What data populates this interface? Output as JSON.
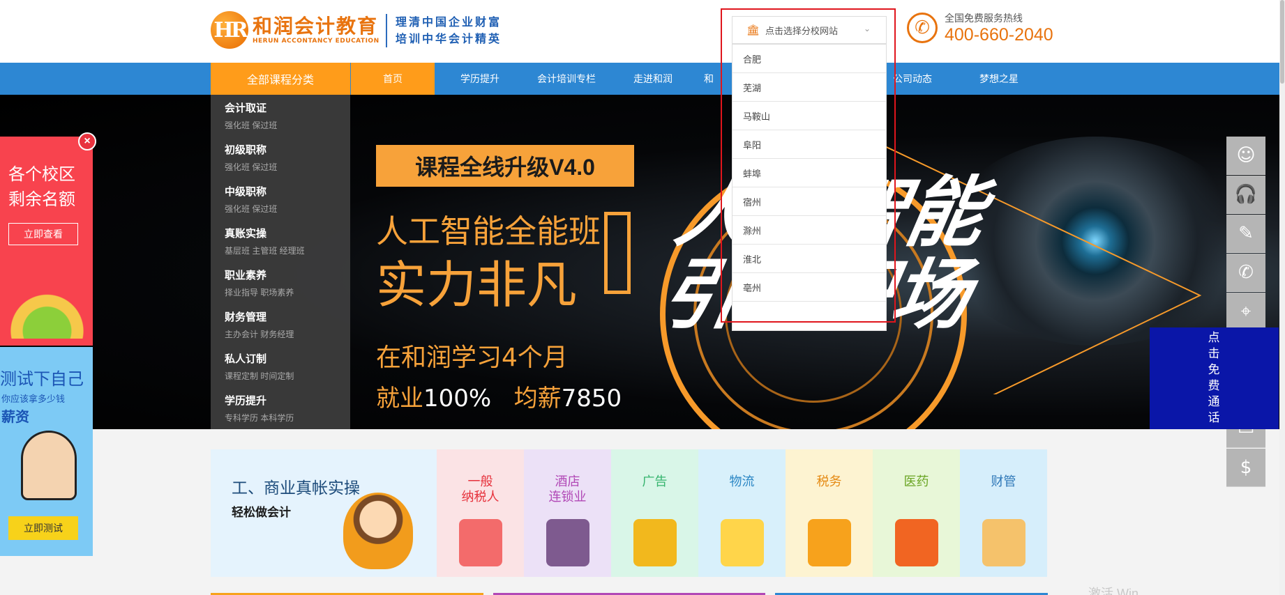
{
  "header": {
    "logo_mark": "HR",
    "logo_cn": "和润会计教育",
    "logo_en": "HERUN ACCONTANCY EDUCATION",
    "slogan_line1": "理清中国企业财富",
    "slogan_line2": "培训中华会计精英",
    "hotline_label": "全国免费服务热线",
    "hotline_number": "400-660-2040"
  },
  "branch_select": {
    "placeholder": "点击选择分校网站",
    "options": [
      "合肥",
      "芜湖",
      "马鞍山",
      "阜阳",
      "蚌埠",
      "宿州",
      "滁州",
      "淮北",
      "亳州"
    ]
  },
  "nav": {
    "category_label": "全部课程分类",
    "items": [
      "首页",
      "学历提升",
      "会计培训专栏",
      "走进和润",
      "和",
      "公司动态",
      "梦想之星"
    ]
  },
  "categories": [
    {
      "title": "会计取证",
      "sub": "强化班  保过班"
    },
    {
      "title": "初级职称",
      "sub": "强化班  保过班"
    },
    {
      "title": "中级职称",
      "sub": "强化班  保过班"
    },
    {
      "title": "真账实操",
      "sub": "基层班  主管班  经理班"
    },
    {
      "title": "职业素养",
      "sub": "择业指导  职场素养"
    },
    {
      "title": "财务管理",
      "sub": "主办会计  财务经理"
    },
    {
      "title": "私人订制",
      "sub": "课程定制  时间定制"
    },
    {
      "title": "学历提升",
      "sub": "专科学历  本科学历"
    }
  ],
  "banner": {
    "tag": "课程全线升级V4.0",
    "line1": "人工智能全能班",
    "line2": "实力非凡",
    "line3": "在和润学习4个月",
    "line4_a": "就业",
    "line4_b": "100%",
    "line4_c": "均薪",
    "line4_d": "7850",
    "big_text_1": "人工智能",
    "big_text_2": "引领职场"
  },
  "ad_left_top": {
    "close": "×",
    "title": "各个校区剩余名额",
    "button": "立即查看"
  },
  "ad_left_bottom": {
    "title": "测试下自己",
    "sub": "你应该拿多少钱",
    "sub2": "薪资",
    "button": "立即测试"
  },
  "side_toolbar": {
    "icons": [
      "user-service-icon",
      "headset-icon",
      "edit-icon",
      "phone-call-icon",
      "location-icon",
      "document-icon",
      "money-bag-icon"
    ],
    "call_panel_text": "点击免费通话"
  },
  "strip": {
    "main_title": "工、商业真帐实操",
    "main_sub": "轻松做会计",
    "tiles": [
      {
        "label": "一般\n纳税人",
        "bg": "#fbe3e5",
        "color": "#e6313b",
        "art": "#f36b6b"
      },
      {
        "label": "酒店\n连锁业",
        "bg": "#ece1f7",
        "color": "#b148b6",
        "art": "#7e5a8f"
      },
      {
        "label": "广告",
        "bg": "#d9f6e8",
        "color": "#36b46e",
        "art": "#f2b81d"
      },
      {
        "label": "物流",
        "bg": "#d8f0fb",
        "color": "#2a86c4",
        "art": "#ffd54a"
      },
      {
        "label": "税务",
        "bg": "#fdf3d1",
        "color": "#e58a14",
        "art": "#f7a21c"
      },
      {
        "label": "医药",
        "bg": "#e8f7d8",
        "color": "#6aa524",
        "art": "#f16522"
      },
      {
        "label": "财管",
        "bg": "#d6eefb",
        "color": "#2f78b8",
        "art": "#f5c26b"
      }
    ]
  },
  "watermark": "激活 Win",
  "colors": {
    "brand_orange": "#ff9c1a",
    "nav_blue": "#2d87d3",
    "call_panel_blue": "#0a16a8",
    "highlight_red": "#e0151c"
  }
}
